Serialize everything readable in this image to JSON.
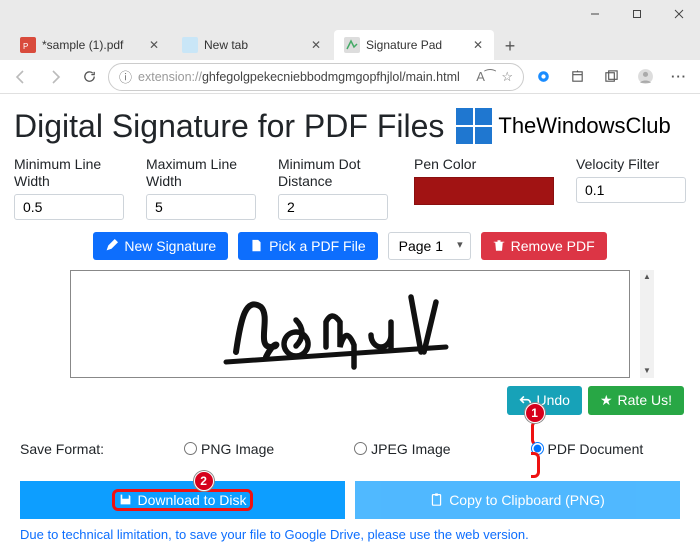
{
  "window": {
    "tabs": [
      {
        "label": "*sample (1).pdf",
        "active": false
      },
      {
        "label": "New tab",
        "active": false
      },
      {
        "label": "Signature Pad",
        "active": true
      }
    ],
    "url_prefix": "extension://",
    "url_rest": "ghfegolgpekecniebbodmgmgopfhjlol/main.html"
  },
  "header": {
    "title": "Digital Signature for PDF Files",
    "brand": "TheWindowsClub"
  },
  "controls": {
    "min_line_label": "Minimum Line Width",
    "min_line_value": "0.5",
    "max_line_label": "Maximum Line Width",
    "max_line_value": "5",
    "min_dot_label": "Minimum Dot Distance",
    "min_dot_value": "2",
    "pen_color_label": "Pen Color",
    "pen_color": "#a11313",
    "vel_filter_label": "Velocity Filter",
    "vel_filter_value": "0.1"
  },
  "buttons": {
    "new_sig": "New Signature",
    "pick_pdf": "Pick a PDF File",
    "page_sel": "Page 1",
    "remove_pdf": "Remove PDF",
    "undo": "Undo",
    "rate": "Rate Us!",
    "download": "Download to Disk",
    "copy": "Copy to Clipboard (PNG)"
  },
  "save": {
    "label": "Save Format:",
    "png": "PNG Image",
    "jpeg": "JPEG Image",
    "pdf": "PDF Document"
  },
  "callouts": {
    "one": "1",
    "two": "2"
  },
  "notice": "Due to technical limitation, to save your file to Google Drive, please use the web version."
}
